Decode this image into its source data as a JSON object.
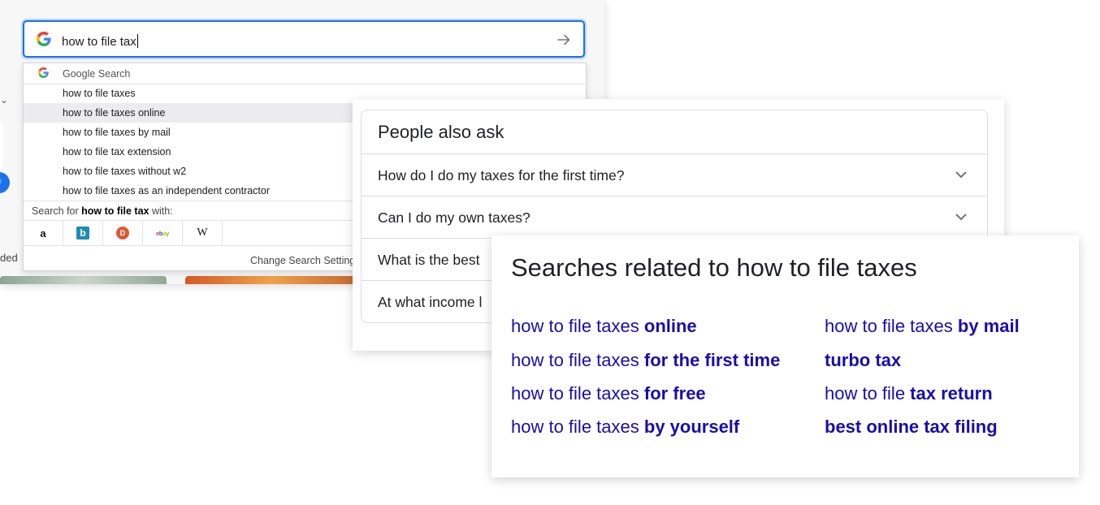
{
  "omnibox": {
    "query": "how to file tax"
  },
  "suggestions_header": "Google Search",
  "suggestions": [
    "how to file taxes",
    "how to file taxes online",
    "how to file taxes by mail",
    "how to file tax extension",
    "how to file taxes without w2",
    "how to file taxes as an independent contractor"
  ],
  "search_with": {
    "prefix": "Search for ",
    "query": "how to file tax",
    "suffix": " with:"
  },
  "search_engines": [
    "amazon-icon",
    "bing-icon",
    "duckduckgo-icon",
    "ebay-icon",
    "wikipedia-icon"
  ],
  "engine_glyphs": {
    "amazon": "a",
    "bing": "b",
    "ddg": "D",
    "ebay": "ebay",
    "wiki": "W"
  },
  "change_settings": "Change Search Settings",
  "background": {
    "partial_text": "ded"
  },
  "people_also_ask": {
    "title": "People also ask",
    "questions": [
      "How do I do my taxes for the first time?",
      "Can I do my own taxes?",
      "What is the best",
      "At what income l"
    ]
  },
  "related": {
    "title": "Searches related to how to file taxes",
    "links": [
      {
        "normal": "how to file taxes ",
        "bold": "online"
      },
      {
        "normal": "how to file taxes ",
        "bold": "by mail"
      },
      {
        "normal": "how to file taxes ",
        "bold": "for the first time"
      },
      {
        "normal": "",
        "bold": "turbo tax"
      },
      {
        "normal": "how to file taxes ",
        "bold": "for free"
      },
      {
        "normal": "how to file ",
        "bold": "tax return"
      },
      {
        "normal": "how to file taxes ",
        "bold": "by yourself"
      },
      {
        "normal": "",
        "bold": "best online tax filing"
      }
    ]
  },
  "colors": {
    "accent": "#1a73e8",
    "link": "#1a0dab",
    "highlight": "#ececef"
  }
}
